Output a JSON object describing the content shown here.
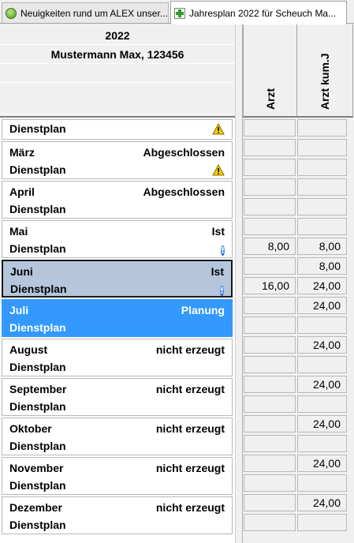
{
  "tabs": [
    {
      "label": "Neuigkeiten rund um ALEX unser...",
      "icon": "alex-green-icon",
      "active": false
    },
    {
      "label": "Jahresplan 2022 für Scheuch Ma...",
      "icon": "calendar-plus-icon",
      "active": true
    }
  ],
  "header": {
    "year": "2022",
    "employee": "Mustermann Max, 123456"
  },
  "columns": [
    "Arzt",
    "Arzt kum.J"
  ],
  "colors": {
    "selected_row": "#b4c5dc",
    "current_row": "#3399ff",
    "warn": "#f2c400",
    "info": "#1452c8"
  },
  "rows": [
    {
      "name": "",
      "status": "",
      "sub": "Dienstplan",
      "icon_bottom": "warning-icon",
      "single": true
    },
    {
      "name": "März",
      "status": "Abgeschlossen",
      "sub": "Dienstplan",
      "icon_bottom": "warning-icon"
    },
    {
      "name": "April",
      "status": "Abgeschlossen",
      "sub": "Dienstplan"
    },
    {
      "name": "Mai",
      "status": "Ist",
      "sub": "Dienstplan",
      "icon_bottom": "info-icon"
    },
    {
      "name": "Juni",
      "status": "Ist",
      "sub": "Dienstplan",
      "icon_bottom": "info-icon",
      "selected": true
    },
    {
      "name": "Juli",
      "status": "Planung",
      "sub": "Dienstplan",
      "current": true
    },
    {
      "name": "August",
      "status": "nicht erzeugt",
      "sub": "Dienstplan"
    },
    {
      "name": "September",
      "status": "nicht erzeugt",
      "sub": "Dienstplan"
    },
    {
      "name": "Oktober",
      "status": "nicht erzeugt",
      "sub": "Dienstplan"
    },
    {
      "name": "November",
      "status": "nicht erzeugt",
      "sub": "Dienstplan"
    },
    {
      "name": "Dezember",
      "status": "nicht erzeugt",
      "sub": "Dienstplan"
    }
  ],
  "cells": [
    [
      "",
      ""
    ],
    [
      "",
      ""
    ],
    [
      "",
      ""
    ],
    [
      "",
      ""
    ],
    [
      "",
      ""
    ],
    [
      "",
      ""
    ],
    [
      "8,00",
      "8,00"
    ],
    [
      "",
      "8,00"
    ],
    [
      "16,00",
      "24,00"
    ],
    [
      "",
      "24,00"
    ],
    [
      "",
      ""
    ],
    [
      "",
      "24,00"
    ],
    [
      "",
      ""
    ],
    [
      "",
      "24,00"
    ],
    [
      "",
      ""
    ],
    [
      "",
      "24,00"
    ],
    [
      "",
      ""
    ],
    [
      "",
      "24,00"
    ],
    [
      "",
      ""
    ],
    [
      "",
      "24,00"
    ],
    [
      "",
      ""
    ]
  ]
}
